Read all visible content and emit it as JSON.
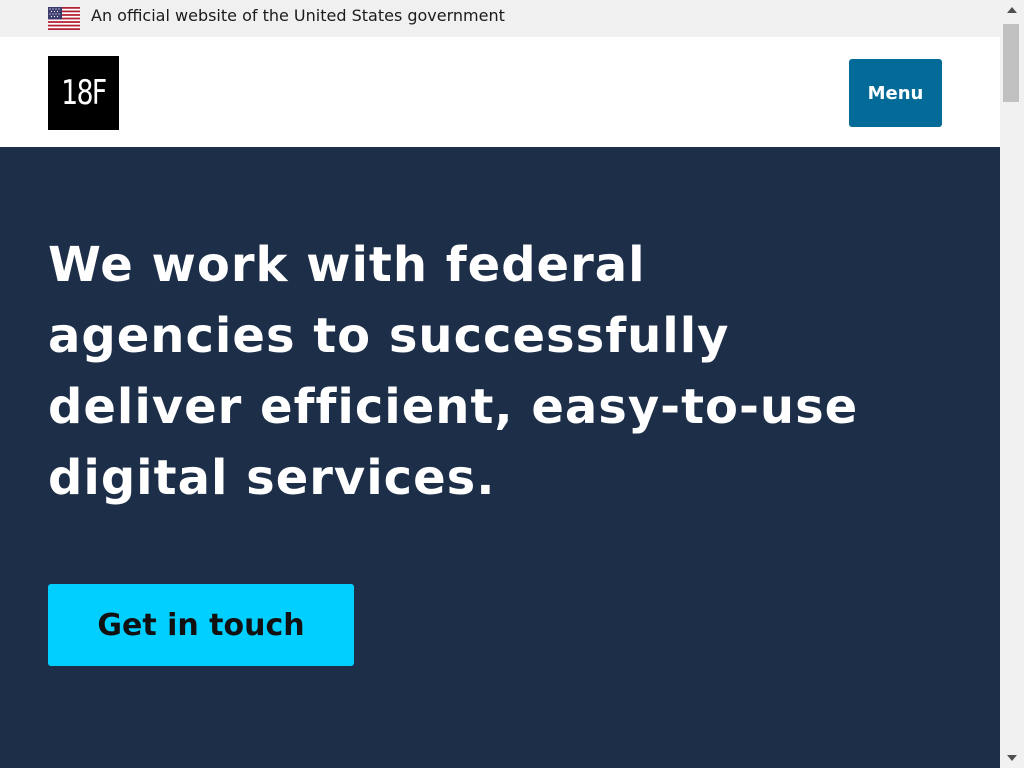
{
  "gov_banner": {
    "text": "An official website of the United States government",
    "icon": "us-flag-icon"
  },
  "header": {
    "logo_text": "18F",
    "menu_label": "Menu"
  },
  "hero": {
    "heading": "We work with federal agencies to successfully deliver efficient, easy-to-use digital services.",
    "cta_label": "Get in touch"
  },
  "colors": {
    "banner_bg": "#f0f0f0",
    "menu_button": "#046b99",
    "hero_bg": "#1c2e48",
    "cta_button": "#00cfff"
  },
  "scrollbar": {
    "up_icon": "scroll-up-arrow-icon",
    "down_icon": "scroll-down-arrow-icon"
  }
}
